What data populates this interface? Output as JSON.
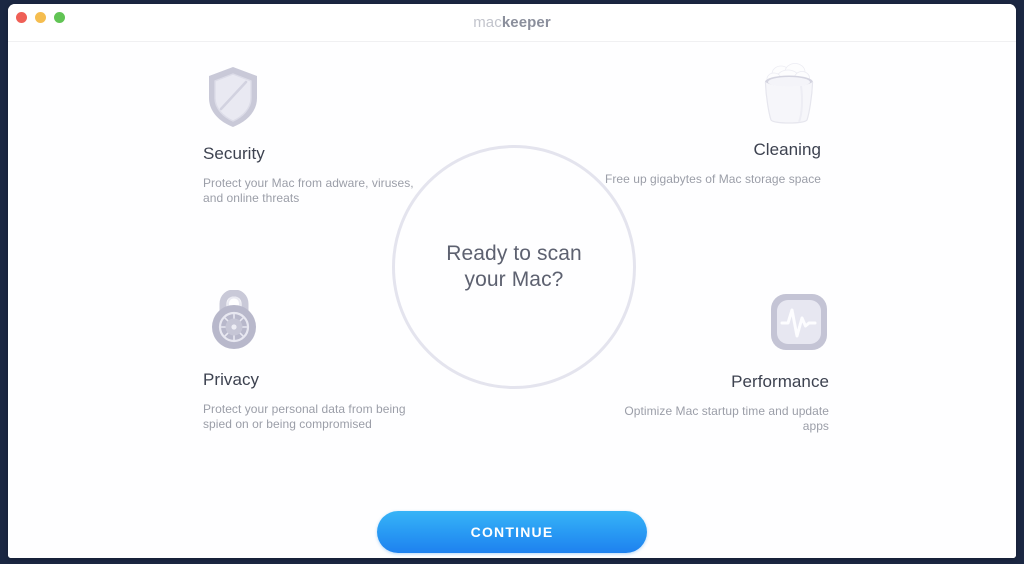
{
  "window": {
    "traffic_lights": [
      {
        "name": "close",
        "color": "#ef5f56"
      },
      {
        "name": "minimize",
        "color": "#f5bd4f"
      },
      {
        "name": "maximize",
        "color": "#61c454"
      }
    ],
    "brand": {
      "part_light": "mac",
      "part_bold": "keeper"
    }
  },
  "scan": {
    "prompt": "Ready to scan\nyour Mac?"
  },
  "features": {
    "security": {
      "icon": "shield-icon",
      "title": "Security",
      "description": "Protect your Mac from adware, viruses, and online threats"
    },
    "cleaning": {
      "icon": "trash-bin-icon",
      "title": "Cleaning",
      "description": "Free up gigabytes of Mac storage space"
    },
    "privacy": {
      "icon": "padlock-icon",
      "title": "Privacy",
      "description": "Protect your personal data from being spied on or being compromised"
    },
    "performance": {
      "icon": "pulse-monitor-icon",
      "title": "Performance",
      "description": "Optimize Mac startup time and update apps"
    }
  },
  "actions": {
    "continue_label": "CONTINUE"
  },
  "colors": {
    "accent_top": "#37b4f7",
    "accent_bottom": "#1e81ef",
    "ring": "#e4e4ee",
    "title_text": "#3d4250",
    "body_text": "#9b9ea8",
    "desktop": "#1b2742"
  }
}
